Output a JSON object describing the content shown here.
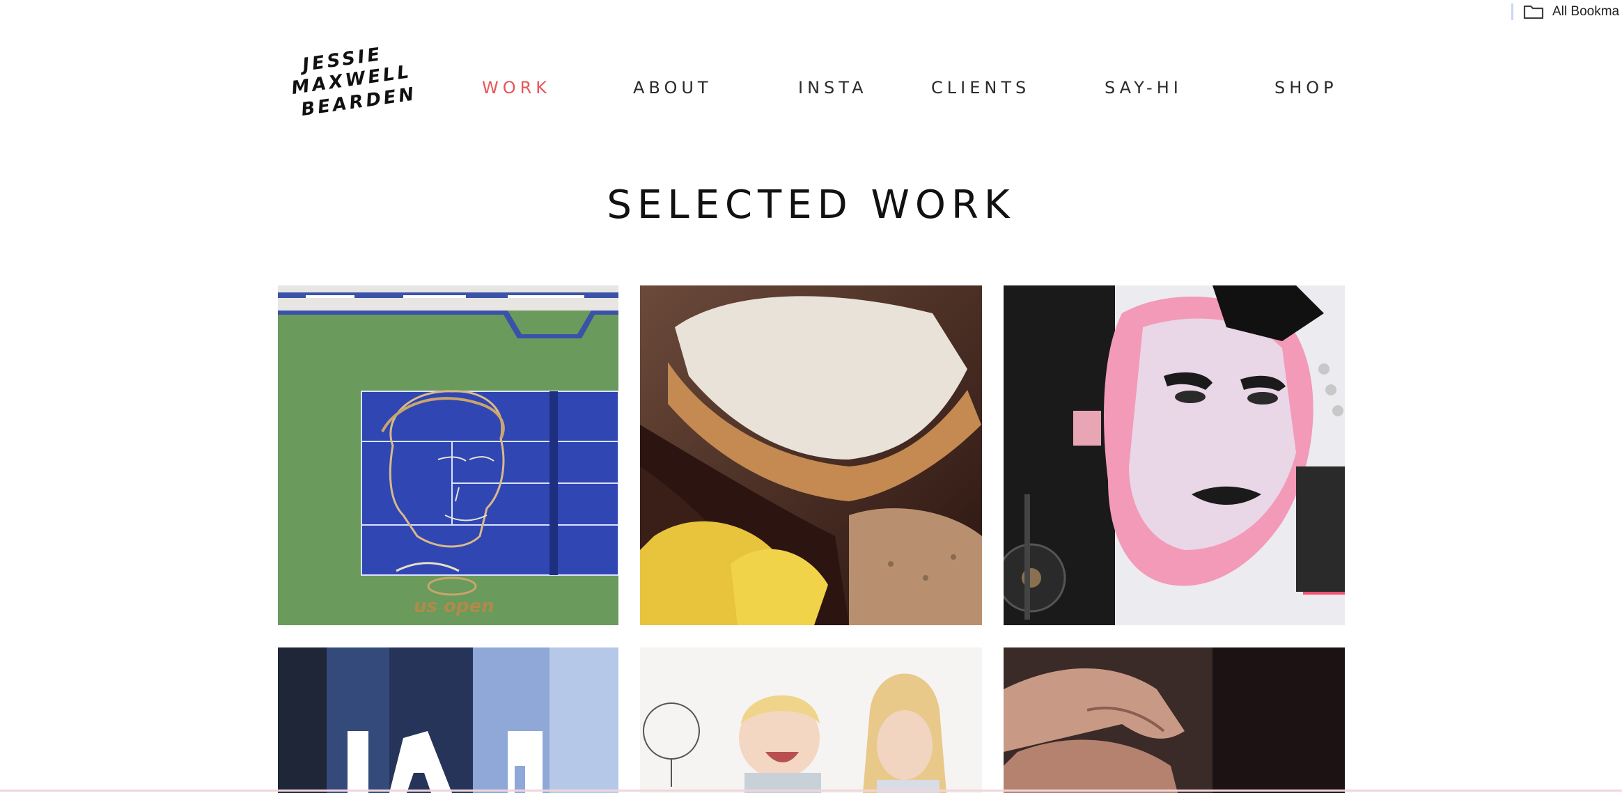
{
  "browser": {
    "bookmarks_label": "All Bookma",
    "bookmarks_icon": "folder-icon"
  },
  "logo": {
    "line1": "JESSIE",
    "line2": "MAXWELL",
    "line3": "BEARDEN"
  },
  "nav": {
    "items": [
      {
        "label": "WORK",
        "active": true
      },
      {
        "label": "ABOUT",
        "active": false
      },
      {
        "label": "INSTA",
        "active": false
      },
      {
        "label": "CLIENTS",
        "active": false
      },
      {
        "label": "SAY-HI",
        "active": false
      },
      {
        "label": "SHOP",
        "active": false
      }
    ],
    "active_color": "#e8565a",
    "text_color": "#2b2b2b"
  },
  "main": {
    "title": "SELECTED WORK"
  },
  "gallery": {
    "tiles": [
      {
        "subject": "tennis-court-portrait",
        "caption": "us open"
      },
      {
        "subject": "dessert-closeup"
      },
      {
        "subject": "pink-portrait-collage"
      },
      {
        "subject": "denim-gap"
      },
      {
        "subject": "kids-illustration"
      },
      {
        "subject": "hand-closeup"
      }
    ]
  }
}
